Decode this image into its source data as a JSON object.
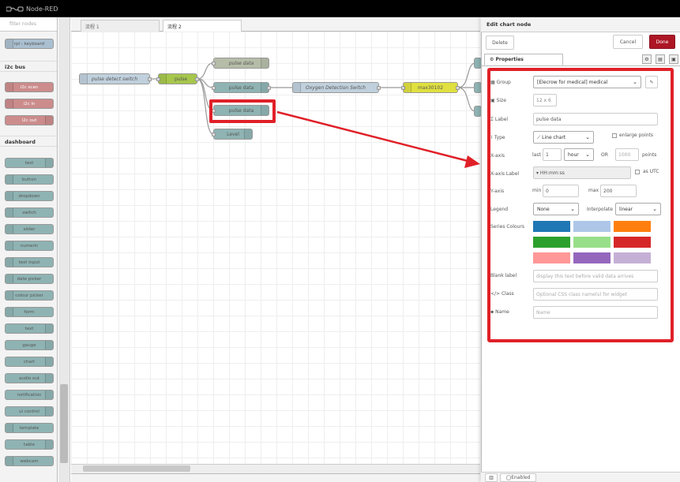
{
  "app": {
    "title": "Node-RED"
  },
  "palette": {
    "filter_placeholder": "filter nodes",
    "top_node": "rpi - keyboard",
    "categories": {
      "i2c": "i2c bus",
      "dashboard": "dashboard"
    },
    "i2c_nodes": [
      "i2c scan",
      "i2c in",
      "i2c out"
    ],
    "dashboard_nodes": [
      "text",
      "button",
      "dropdown",
      "switch",
      "slider",
      "numeric",
      "text input",
      "date picker",
      "colour picker",
      "form",
      "text",
      "gauge",
      "chart",
      "audio out",
      "notification",
      "ui control",
      "template",
      "table",
      "webcam"
    ]
  },
  "workspace": {
    "tabs": [
      "流程 1",
      "流程 2"
    ],
    "nodes": {
      "pulse_detect": "pulse detect switch",
      "pulse": "pulse",
      "pulse_data_top": "pulse data",
      "pulse_data_mid": "pulse data",
      "pulse_data_sel": "pulse data",
      "level": "Level",
      "oxygen": "Oxygen Detection Switch",
      "max30102": "max30102"
    }
  },
  "tray": {
    "title": "Edit chart node",
    "delete_label": "Delete",
    "cancel_label": "Cancel",
    "done_label": "Done",
    "properties_tab": "Properties",
    "footer_enabled": "Enabled",
    "form": {
      "group_label": "Group",
      "group_value": "[Elecrow for medical] medical",
      "size_label": "Size",
      "size_value": "12 x 6",
      "label_label": "Label",
      "label_value": "pulse data",
      "type_label": "Type",
      "type_value": "Line chart",
      "enlarge_points": "enlarge points",
      "xaxis_label": "X-axis",
      "xaxis_last": "last",
      "xaxis_num": "1",
      "xaxis_unit": "hour",
      "xaxis_or": "OR",
      "xaxis_points_placeholder": "1000",
      "xaxis_points": "points",
      "xaxis_label_label": "X-axis Label",
      "xaxis_label_value": "HH:mm:ss",
      "as_utc": "as UTC",
      "yaxis_label": "Y-axis",
      "ymin_label": "min",
      "ymin_value": "0",
      "ymax_label": "max",
      "ymax_value": "200",
      "legend_label": "Legend",
      "legend_value": "None",
      "interpolate_label": "Interpolate",
      "interpolate_value": "linear",
      "series_colours_label": "Series Colours",
      "series_colours": [
        "#1f77b4",
        "#aec7e8",
        "#ff7f0e",
        "#2ca02c",
        "#98df8a",
        "#d62728",
        "#ff9896",
        "#9467bd",
        "#c5b0d5"
      ],
      "blank_label": "Blank label",
      "blank_placeholder": "display this text before valid data arrives",
      "class_label": "Class",
      "class_placeholder": "Optional CSS class name(s) for widget",
      "name_label": "Name",
      "name_placeholder": "Name"
    }
  },
  "colors": {
    "highlight": "#e02028",
    "done": "#ad1625"
  }
}
